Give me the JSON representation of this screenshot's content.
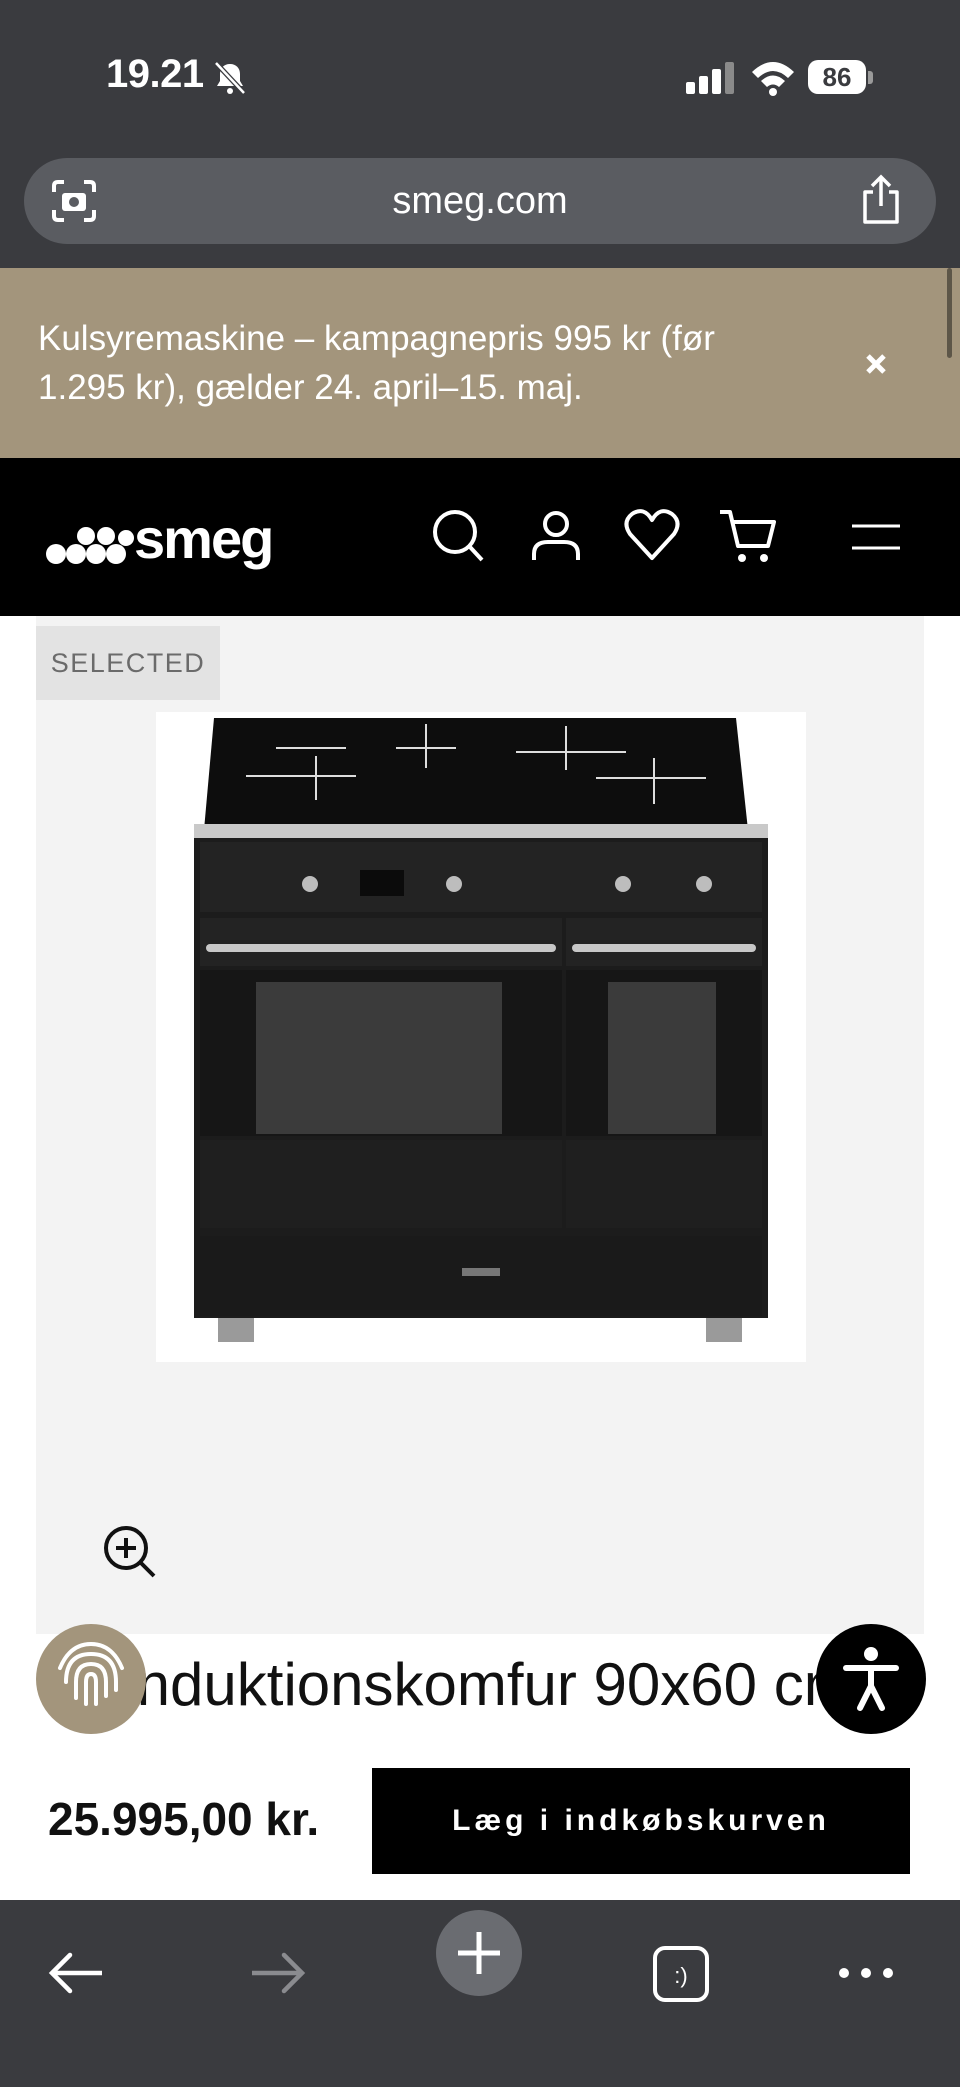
{
  "status_bar": {
    "time": "19.21",
    "battery": "86"
  },
  "browser": {
    "url": "smeg.com"
  },
  "promo": {
    "text": "Kulsyremaskine – kampagnepris 995 kr (før 1.295 kr), gælder 24. april–15. maj."
  },
  "header": {
    "logo": "smeg"
  },
  "gallery": {
    "badge": "SELECTED"
  },
  "product": {
    "title": "Induktionskomfur 90x60 cm",
    "price": "25.995,00 kr.",
    "add_to_cart": "Læg i indkøbskurven"
  },
  "colors": {
    "promo_bg": "#a3957c",
    "header_bg": "#000000",
    "browser_chrome": "#3a3b3f"
  }
}
